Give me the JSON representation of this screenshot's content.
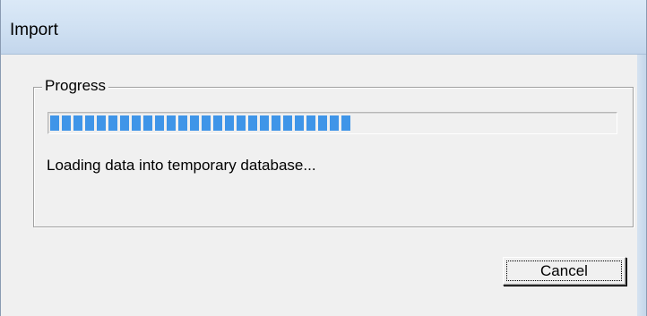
{
  "window": {
    "title": "Import"
  },
  "progress_group": {
    "legend": "Progress",
    "progress_fraction": 0.55,
    "status_text": "Loading data into temporary database...",
    "bar_color": "#3f95e8"
  },
  "buttons": {
    "cancel_label": "Cancel"
  }
}
